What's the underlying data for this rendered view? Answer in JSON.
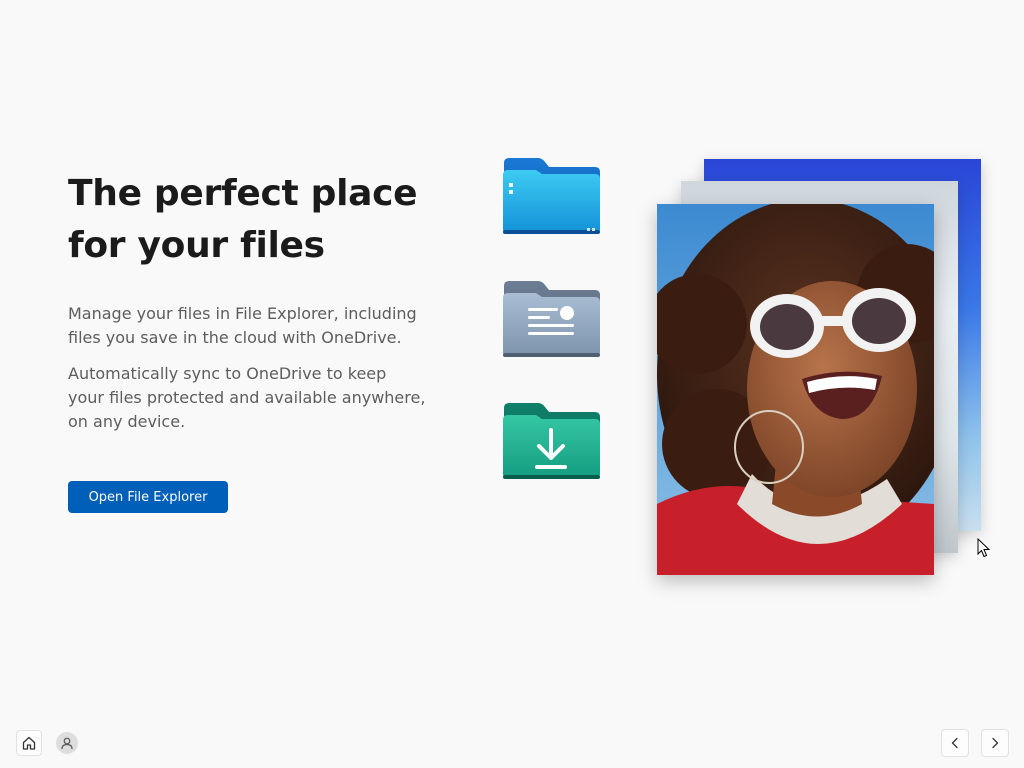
{
  "main": {
    "title_lines": [
      "The perfect place",
      "for your files"
    ],
    "paragraph1_lines": [
      "Manage your files in File Explorer, including",
      "files you save in the cloud with OneDrive."
    ],
    "paragraph2_lines": [
      "Automatically sync to OneDrive to keep",
      "your files protected and available anywhere,",
      "on any device."
    ],
    "primary_button_label": "Open File Explorer"
  },
  "illustration": {
    "folders": [
      "folder-icon",
      "documents-folder-icon",
      "downloads-folder-icon"
    ],
    "photo_stack": [
      "blue-sky-photo",
      "grey-landscape-photo",
      "portrait-photo"
    ]
  },
  "footer": {
    "left_icons": [
      "home-icon",
      "user-icon"
    ],
    "right_icons": [
      "chevron-left-icon",
      "chevron-right-icon"
    ]
  },
  "colors": {
    "background": "#f9f9f9",
    "accent": "#005fb8",
    "title_text": "#1b1b1b",
    "body_text": "#5d5d5d"
  }
}
